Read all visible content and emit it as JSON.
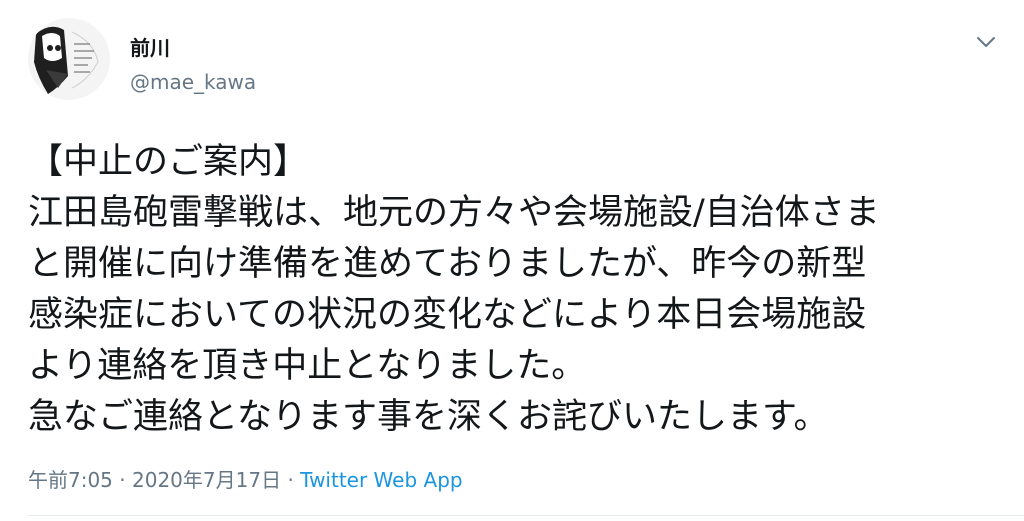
{
  "author": {
    "display_name": "前川",
    "handle": "@mae_kawa",
    "avatar_icon": "manga-avatar-icon"
  },
  "menu": {
    "icon": "chevron-down-icon"
  },
  "tweet": {
    "lines": [
      "【中止のご案内】",
      "江田島砲雷撃戦は、地元の方々や会場施設/自治体さま",
      "と開催に向け準備を進めておりましたが、昨今の新型",
      "感染症においての状況の変化などにより本日会場施設",
      "より連絡を頂き中止となりました。",
      "急なご連絡となります事を深くお詫びいたします。"
    ]
  },
  "meta": {
    "time": "午前7:05",
    "separator": "·",
    "date": "2020年7月17日",
    "app": "Twitter Web App"
  },
  "colors": {
    "text": "#14171a",
    "secondary": "#657786",
    "link": "#1b95e0",
    "divider": "#e6ecf0"
  }
}
